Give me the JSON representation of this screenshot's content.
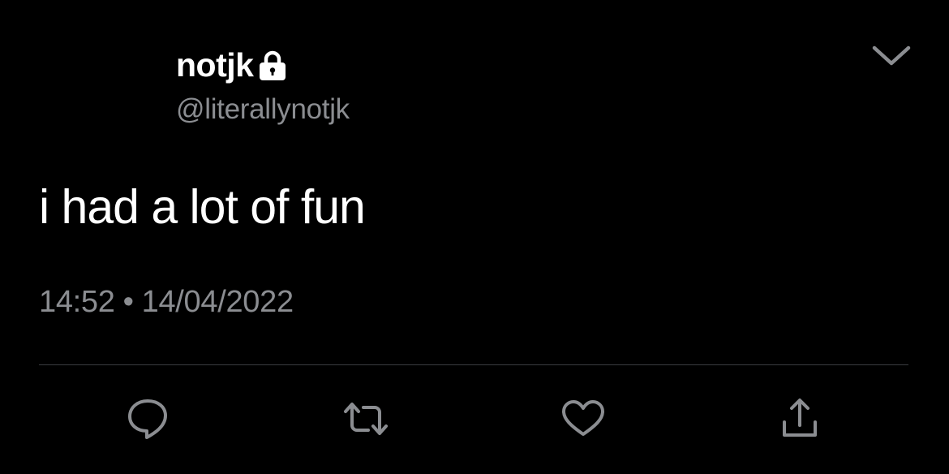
{
  "user": {
    "display_name": "notjk",
    "handle": "@literallynotjk",
    "protected": true
  },
  "tweet": {
    "text": "i had a lot of fun",
    "time": "14:52",
    "separator": "•",
    "date": "14/04/2022"
  },
  "icons": {
    "lock": "lock-icon",
    "menu": "chevron-down-icon",
    "reply": "reply-icon",
    "retweet": "retweet-icon",
    "like": "heart-icon",
    "share": "share-icon"
  },
  "colors": {
    "background": "#000000",
    "primary_text": "#ffffff",
    "secondary_text": "#8b8d91",
    "icon": "#8b8d91",
    "divider": "#3a3c40"
  }
}
